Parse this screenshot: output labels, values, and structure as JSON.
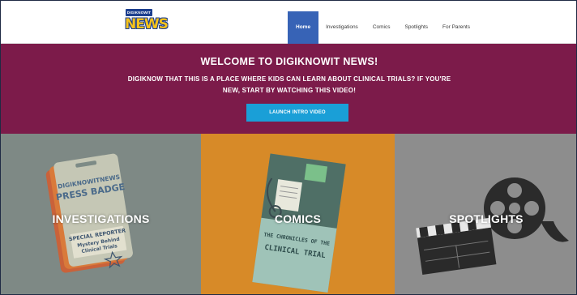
{
  "header": {
    "logo": {
      "tag_text": "DIGIKNOWIT",
      "word": "NEWS"
    },
    "nav": [
      {
        "label": "Home",
        "active": true
      },
      {
        "label": "Investigations",
        "active": false
      },
      {
        "label": "Comics",
        "active": false
      },
      {
        "label": "Spotlights",
        "active": false
      },
      {
        "label": "For Parents",
        "active": false
      }
    ]
  },
  "hero": {
    "title": "WELCOME TO DIGIKNOWIT NEWS!",
    "subtitle": "DIGIKNOW THAT THIS IS A PLACE WHERE KIDS CAN LEARN ABOUT CLINICAL TRIALS? IF YOU'RE NEW, START BY WATCHING THIS VIDEO!",
    "cta_label": "LAUNCH INTRO VIDEO",
    "background_color": "#7c1b4a",
    "cta_color": "#1a9fd7"
  },
  "tiles": [
    {
      "label": "INVESTIGATIONS",
      "color": "#7e8985",
      "art": {
        "icon": "press-badge-icon",
        "line1": "DIGIKNOWITNEWS",
        "line2": "PRESS BADGE",
        "line3": "SPECIAL REPORTER",
        "line4": "Mystery Behind",
        "line5": "Clinical Trials"
      }
    },
    {
      "label": "COMICS",
      "color": "#d78a28",
      "art": {
        "icon": "comic-book-icon",
        "line1": "THE CHRONICLES OF THE",
        "line2": "CLINICAL TRIAL"
      }
    },
    {
      "label": "SPOTLIGHTS",
      "color": "#8d8d8d",
      "art": {
        "icon": "film-reel-clapper-icon"
      }
    }
  ]
}
